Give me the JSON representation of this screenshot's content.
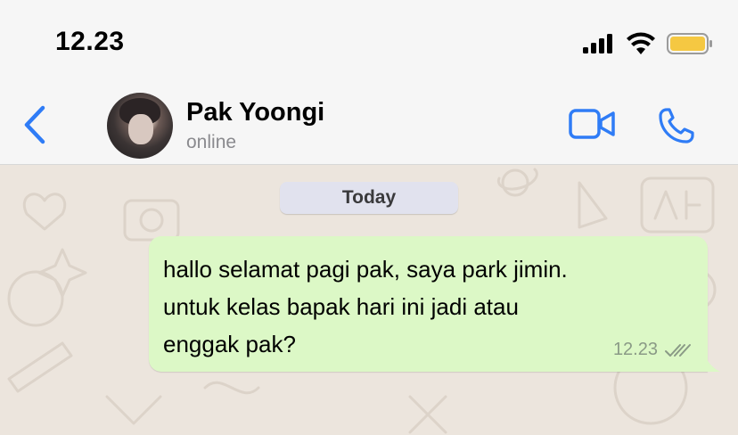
{
  "status_bar": {
    "time": "12.23",
    "signal_icon": "signal-bars-icon",
    "wifi_icon": "wifi-icon",
    "battery_icon": "battery-icon",
    "battery_color": "#f5c842"
  },
  "header": {
    "back_icon": "chevron-left-icon",
    "contact_name": "Pak Yoongi",
    "contact_status": "online",
    "video_icon": "video-camera-icon",
    "call_icon": "phone-icon",
    "accent_color": "#2f7cf6"
  },
  "chat": {
    "date_label": "Today",
    "messages": [
      {
        "direction": "outgoing",
        "lines": [
          "hallo selamat pagi pak, saya park jimin.",
          "untuk kelas bapak hari ini jadi atau",
          "enggak pak?"
        ],
        "time": "12.23",
        "status_icon": "double-check-icon",
        "bubble_color": "#dcf8c6"
      }
    ]
  }
}
